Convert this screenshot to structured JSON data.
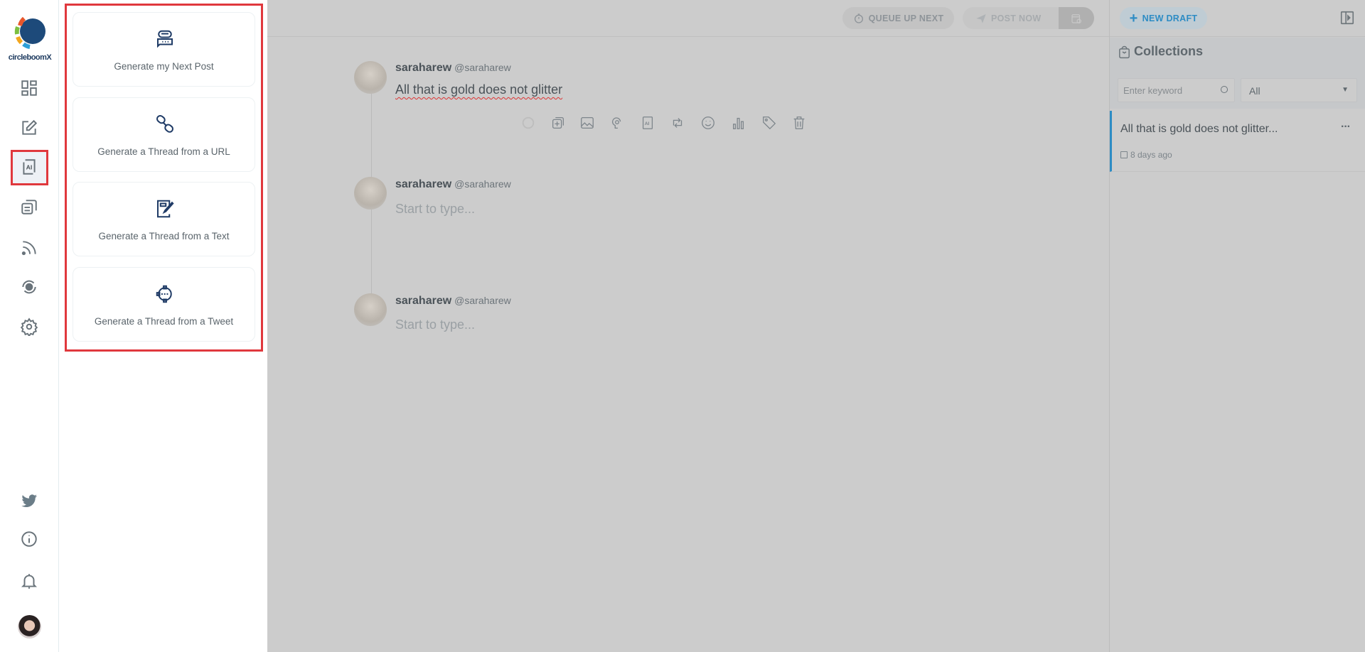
{
  "brand": {
    "logo_text": "circleboomX"
  },
  "sidebar": {
    "items": [
      {
        "name": "dashboard-icon"
      },
      {
        "name": "compose-icon"
      },
      {
        "name": "ai-icon",
        "active": true,
        "label": "AI"
      },
      {
        "name": "drafts-icon"
      },
      {
        "name": "rss-icon"
      },
      {
        "name": "schedule-icon"
      },
      {
        "name": "settings-icon"
      }
    ],
    "bottom": [
      {
        "name": "twitter-icon"
      },
      {
        "name": "info-icon"
      },
      {
        "name": "bell-icon"
      },
      {
        "name": "user-avatar"
      }
    ]
  },
  "ai_panel": {
    "cards": [
      {
        "label": "Generate my Next Post",
        "icon": "chat-bubble-icon"
      },
      {
        "label": "Generate a Thread from a URL",
        "icon": "link-icon"
      },
      {
        "label": "Generate a Thread from a Text",
        "icon": "note-edit-icon"
      },
      {
        "label": "Generate a Thread from a Tweet",
        "icon": "target-icon"
      }
    ]
  },
  "toolbar": {
    "queue_label": "QUEUE UP NEXT",
    "post_now_label": "POST NOW"
  },
  "thread": {
    "posts": [
      {
        "name": "saraharew",
        "handle": "@saraharew",
        "text": "All that is gold does not glitter"
      },
      {
        "name": "saraharew",
        "handle": "@saraharew",
        "placeholder": "Start to type..."
      },
      {
        "name": "saraharew",
        "handle": "@saraharew",
        "placeholder": "Start to type..."
      }
    ],
    "tools": [
      "loading-icon",
      "add-post-icon",
      "image-icon",
      "gif-icon",
      "ai-icon",
      "retweet-icon",
      "emoji-icon",
      "poll-icon",
      "tag-icon",
      "trash-icon"
    ]
  },
  "right": {
    "new_draft_label": "NEW DRAFT",
    "collections_title": "Collections",
    "search_placeholder": "Enter keyword",
    "filter_value": "All",
    "items": [
      {
        "title": "All that is gold does not glitter...",
        "date": "8 days ago"
      }
    ]
  },
  "colors": {
    "highlight": "#e0383d",
    "accent": "#2d8cc4",
    "overlay": "#cccccc",
    "icon_navy": "#1f3b66"
  }
}
